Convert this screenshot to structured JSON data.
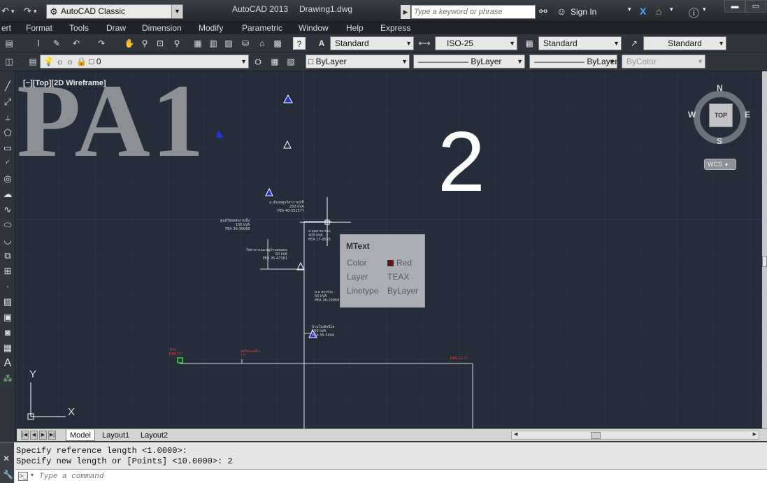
{
  "titlebar": {
    "workspace": "AutoCAD Classic",
    "app_title": "AutoCAD 2013",
    "document": "Drawing1.dwg",
    "search_placeholder": "Type a keyword or phrase",
    "signin_label": "Sign In"
  },
  "menu": [
    "ert",
    "Format",
    "Tools",
    "Draw",
    "Dimension",
    "Modify",
    "Parametric",
    "Window",
    "Help",
    "Express"
  ],
  "styles_toolbar": {
    "text_style": "Standard",
    "dim_style": "ISO-25",
    "table_style": "Standard",
    "mleader_style": "Standard"
  },
  "layers_toolbar": {
    "current_layer": "0",
    "color": "ByLayer",
    "linetype": "ByLayer",
    "lineweight": "ByLayer",
    "plotstyle": "ByColor"
  },
  "canvas": {
    "view_label": "[−][Top][2D Wireframe]",
    "big_text_left": "PA1",
    "big_text_right": "2",
    "thai_labels": [
      "อ.เมืองสตูลวิสาการณ์ชื่\n250 kVA\nPEA 40-35157?",
      "ศูนย์วิจัยพลังงานชั้น\n100 kVA\nPEA 36-39068",
      "ส.อุตสาหกรรม\n400 kVA\nPEA 17-0555",
      "ไฟสาธารณะหมู่บ้านสมอผอ\n50 kVA\nPEA 35-47381",
      "ส.อ พระประ\n50 kVA\nPEA 26-10950",
      "บ้านโป่งสิงนีโฮ\n500 kVA\nPEA 35-5404"
    ],
    "red_labels": [
      "TH0\nRPA-???",
      "สตรีหนองหิน\n???",
      "RPA-11-??"
    ],
    "viewcube": {
      "n": "N",
      "s": "S",
      "e": "E",
      "w": "W",
      "face": "TOP",
      "wcs": "WCS"
    },
    "ucs": {
      "x": "X",
      "y": "Y"
    }
  },
  "tooltip": {
    "title": "MText",
    "rows": [
      {
        "label": "Color",
        "value": "Red"
      },
      {
        "label": "Layer",
        "value": "TEAX"
      },
      {
        "label": "Linetype",
        "value": "ByLayer"
      }
    ],
    "swatch_color": "#8b0000"
  },
  "tabs": [
    "Model",
    "Layout1",
    "Layout2"
  ],
  "command": {
    "history": [
      "Specify reference length <1.0000>:",
      "Specify new length or [Points] <10.0000>: 2"
    ],
    "placeholder": "Type a command"
  },
  "colors": {
    "canvas_bg": "#252d3b",
    "grid": "#2f3847",
    "accent_blue": "#2233dd",
    "red": "#e03a3a"
  }
}
